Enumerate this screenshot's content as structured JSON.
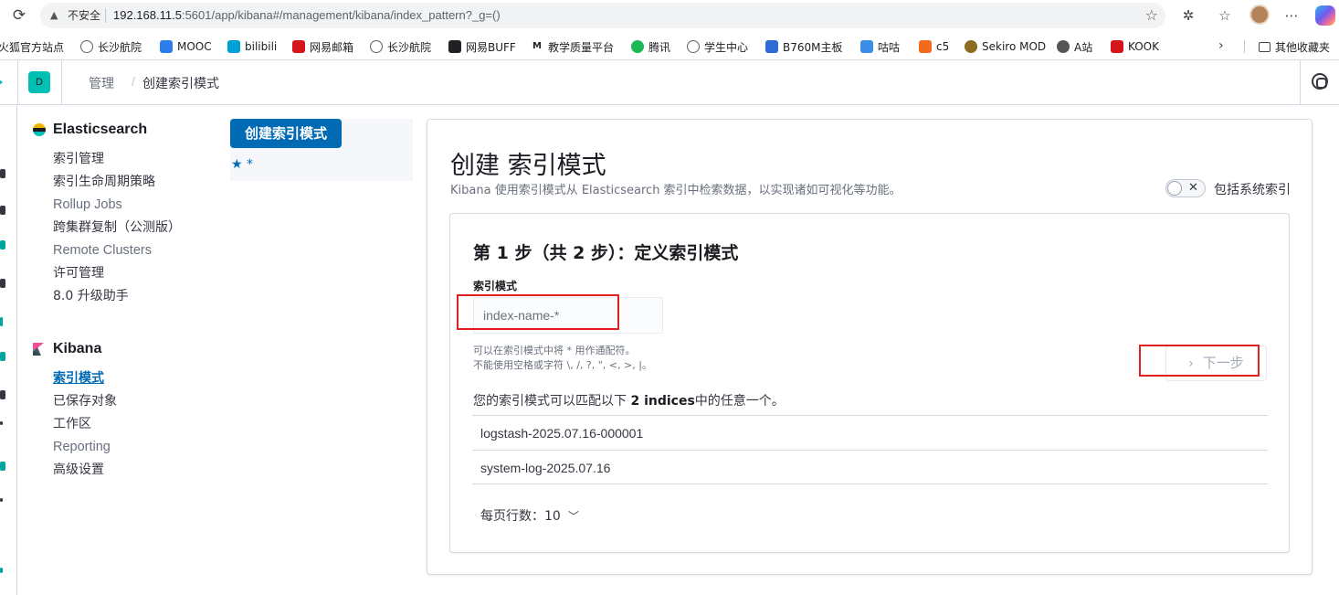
{
  "browser": {
    "insecure_label": "不安全",
    "url_host": "192.168.11.5",
    "url_rest": ":5601/app/kibana#/management/kibana/index_pattern?_g=()"
  },
  "bookmarks": [
    {
      "label": "火狐官方站点",
      "color": "#ff7139"
    },
    {
      "label": "长沙航院",
      "color": "#5f6368"
    },
    {
      "label": "MOOC",
      "color": "#2b7de9"
    },
    {
      "label": "bilibili",
      "color": "#00a1d6"
    },
    {
      "label": "网易邮箱",
      "color": "#d6141b"
    },
    {
      "label": "长沙航院",
      "color": "#5f6368"
    },
    {
      "label": "网易BUFF",
      "color": "#202124"
    },
    {
      "label": "教学质量平台",
      "color": "#202124"
    },
    {
      "label": "腾讯",
      "color": "#1db954"
    },
    {
      "label": "学生中心",
      "color": "#5f6368"
    },
    {
      "label": "B760M主板",
      "color": "#2e6bd6"
    },
    {
      "label": "咕咕",
      "color": "#3a8ee6"
    },
    {
      "label": "c5",
      "color": "#f26b1d"
    },
    {
      "label": "Sekiro MOD",
      "color": "#8a6d1f"
    },
    {
      "label": "A站",
      "color": "#555555"
    },
    {
      "label": "KOOK",
      "color": "#d6141b"
    }
  ],
  "bookmarks_other": "其他收藏夹",
  "header": {
    "space_initial": "D",
    "breadcrumb_root": "管理",
    "breadcrumb_current": "创建索引模式"
  },
  "sidebar": {
    "elasticsearch": {
      "title": "Elasticsearch",
      "items": [
        "索引管理",
        "索引生命周期策略",
        "Rollup Jobs",
        "跨集群复制（公测版）",
        "Remote Clusters",
        "许可管理",
        "8.0 升级助手"
      ]
    },
    "kibana": {
      "title": "Kibana",
      "items": [
        "索引模式",
        "已保存对象",
        "工作区",
        "Reporting",
        "高级设置"
      ],
      "active_index": 0
    }
  },
  "index_patterns": {
    "create_button": "创建索引模式",
    "favorite": "*"
  },
  "main": {
    "title": "创建 索引模式",
    "subtitle": "Kibana 使用索引模式从 Elasticsearch 索引中检索数据，以实现诸如可视化等功能。",
    "toggle_label": "包括系统索引",
    "toggle_on": false,
    "step_title": "第 1 步（共 2 步）：定义索引模式",
    "field_label": "索引模式",
    "field_placeholder": "index-name-*",
    "field_value": "",
    "help_line_1": "可以在索引模式中将 * 用作通配符。",
    "help_line_2": "不能使用空格或字符 \\, /, ?, \", <, >, |。",
    "next_button": "下一步",
    "match_prefix": "您的索引模式可以匹配以下 ",
    "match_count": "2 indices",
    "match_suffix": "中的任意一个。",
    "indices": [
      "logstash-2025.07.16-000001",
      "system-log-2025.07.16"
    ],
    "rows_per_page_label": "每页行数：",
    "rows_per_page_value": "10"
  },
  "colors": {
    "primary": "#006bb4",
    "accent_teal": "#00bfb3",
    "highlight_red": "#e02020"
  }
}
